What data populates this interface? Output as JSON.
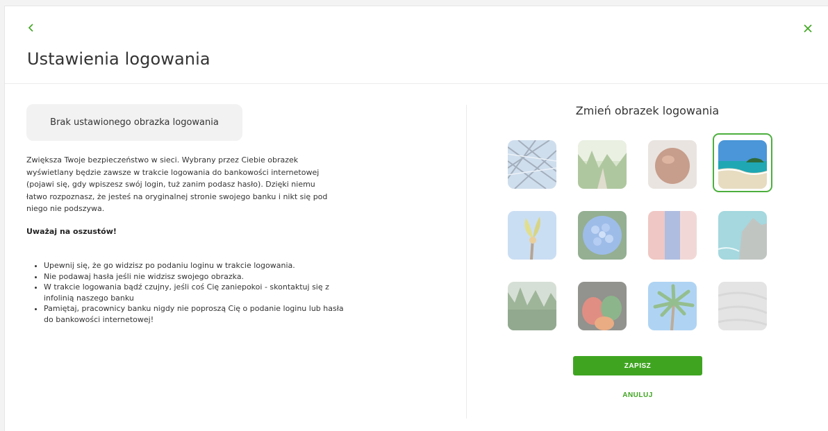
{
  "header": {
    "title": "Ustawienia logowania",
    "back_icon": "chevron-left-icon",
    "close_icon": "close-icon",
    "accent_color": "#3fa521"
  },
  "left": {
    "no_image_label": "Brak ustawionego obrazka logowania",
    "description": "Zwiększa Twoje bezpieczeństwo w sieci. Wybrany przez Ciebie obrazek wyświetlany będzie zawsze w trakcie logowania do bankowości internetowej (pojawi się, gdy wpiszesz swój login, tuż zanim podasz hasło). Dzięki niemu łatwo rozpoznasz, że jesteś na oryginalnej stronie swojego banku i nikt się pod niego nie podszywa.",
    "warning": "Uważaj na oszustów!",
    "tips": [
      "Upewnij się, że go widzisz po podaniu loginu w trakcie logowania.",
      "Nie podawaj hasła jeśli nie widzisz swojego obrazka.",
      "W trakcie logowania bądź czujny, jeśli coś Cię zaniepokoi - skontaktuj się z infolinią naszego banku",
      "Pamiętaj, pracownicy banku nigdy nie poproszą Cię o podanie loginu lub hasła do bankowości internetowej!"
    ]
  },
  "right": {
    "title": "Zmień obrazek logowania",
    "images": [
      {
        "name": "glass-roof",
        "selected": false
      },
      {
        "name": "forest-path",
        "selected": false
      },
      {
        "name": "chestnut",
        "selected": false
      },
      {
        "name": "beach",
        "selected": true
      },
      {
        "name": "flower-bud",
        "selected": false
      },
      {
        "name": "hydrangea",
        "selected": false
      },
      {
        "name": "colored-stripes",
        "selected": false
      },
      {
        "name": "sea-rocks",
        "selected": false
      },
      {
        "name": "misty-forest",
        "selected": false
      },
      {
        "name": "peppers",
        "selected": false
      },
      {
        "name": "palm-tree",
        "selected": false
      },
      {
        "name": "sand-texture",
        "selected": false
      }
    ],
    "save_label": "ZAPISZ",
    "cancel_label": "ANULUJ"
  }
}
